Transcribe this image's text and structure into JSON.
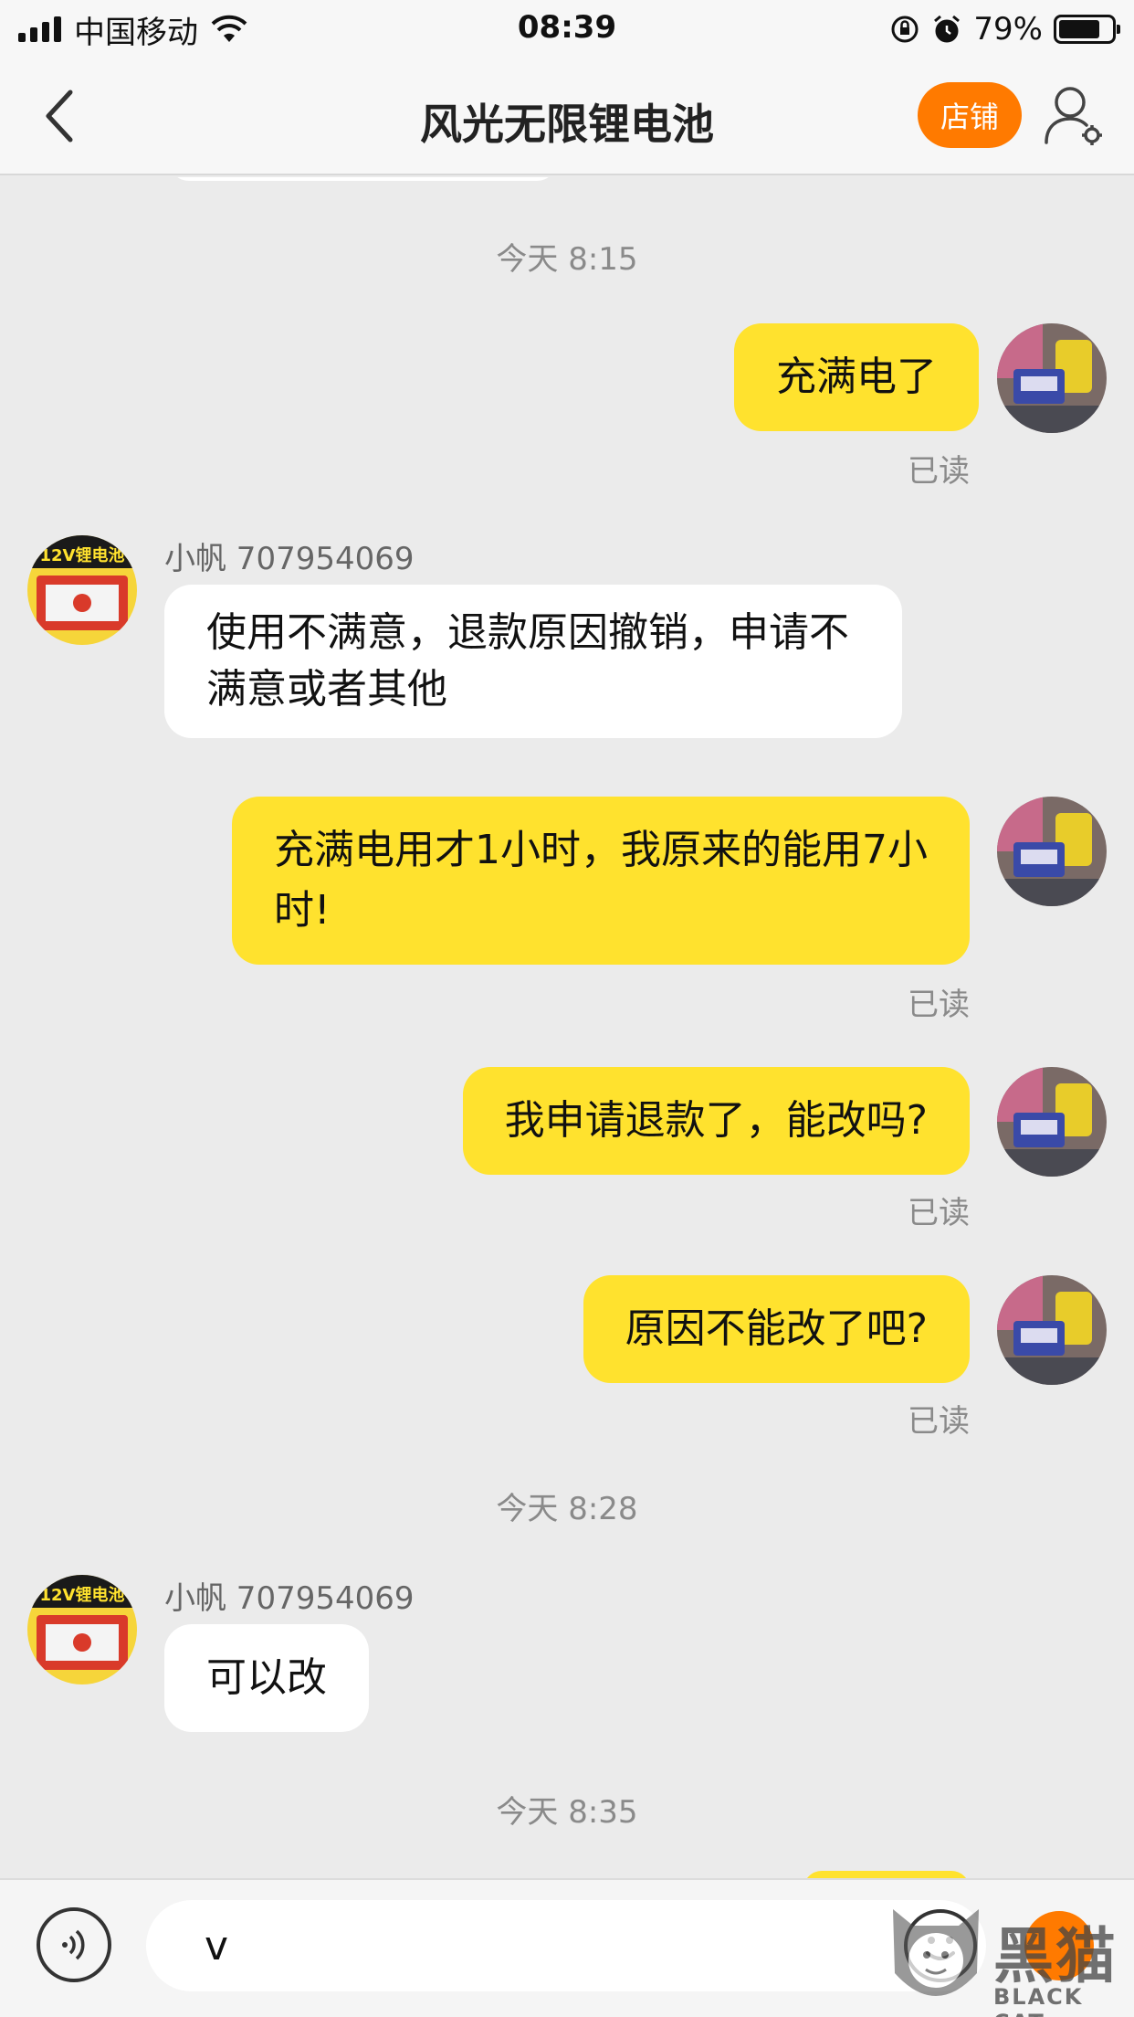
{
  "status_bar": {
    "carrier": "中国移动",
    "time": "08:39",
    "battery": "79%",
    "battery_level": 0.79
  },
  "nav": {
    "title": "风光无限锂电池",
    "shop_label": "店铺"
  },
  "messages": [
    {
      "type": "time",
      "text": "今天 8:15"
    },
    {
      "type": "self",
      "text": "充满电了",
      "status": "已读"
    },
    {
      "type": "other",
      "sender": "小帆 707954069",
      "text": "使用不满意，退款原因撤销，申请不满意或者其他"
    },
    {
      "type": "self",
      "text": "充满电用才1小时，我原来的能用7小时!",
      "status": "已读"
    },
    {
      "type": "self",
      "text": "我申请退款了，能改吗?",
      "status": "已读"
    },
    {
      "type": "self",
      "text": "原因不能改了吧?",
      "status": "已读"
    },
    {
      "type": "time",
      "text": "今天 8:28"
    },
    {
      "type": "other",
      "sender": "小帆 707954069",
      "text": "可以改"
    },
    {
      "type": "time",
      "text": "今天 8:35"
    }
  ],
  "input": {
    "value": "v"
  },
  "shop_avatar_text": "12V锂电池",
  "watermark": {
    "text": "黑猫",
    "sub": "BLACK CAT"
  },
  "colors": {
    "self_bubble": "#ffe22e",
    "other_bubble": "#ffffff",
    "accent": "#ff7a00",
    "background": "#ebebeb"
  }
}
